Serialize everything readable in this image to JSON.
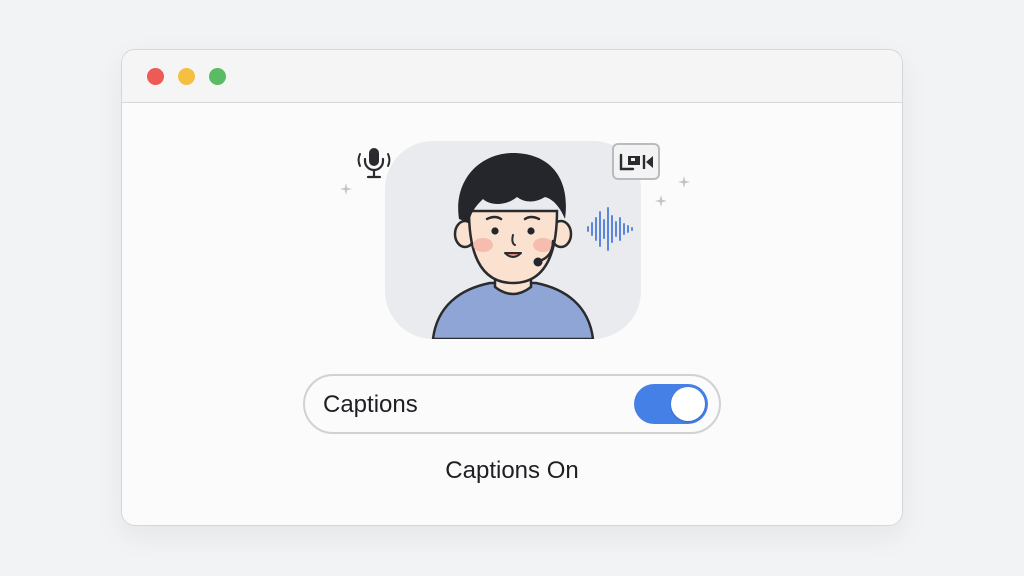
{
  "window": {
    "traffic_lights": [
      "close",
      "minimize",
      "maximize"
    ]
  },
  "video": {
    "icons": [
      "microphone-icon",
      "camera-icon",
      "audio-waveform-icon"
    ]
  },
  "captions": {
    "label": "Captions",
    "toggle_on": true,
    "status": "Captions On"
  },
  "colors": {
    "accent": "#4580e6",
    "close": "#ec5b56",
    "minimize": "#f4c042",
    "maximize": "#5bbb62"
  }
}
